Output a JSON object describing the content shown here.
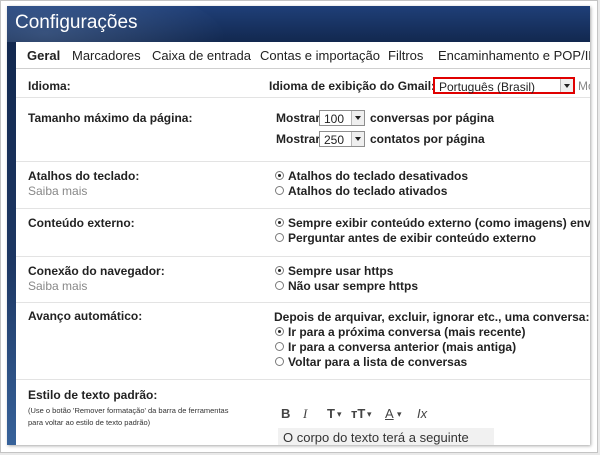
{
  "header": {
    "title": "Configurações"
  },
  "tabs": [
    {
      "label": "Geral"
    },
    {
      "label": "Marcadores"
    },
    {
      "label": "Caixa de entrada"
    },
    {
      "label": "Contas e importação"
    },
    {
      "label": "Filtros"
    },
    {
      "label": "Encaminhamento e POP/IMAP"
    }
  ],
  "idioma": {
    "label": "Idioma:",
    "display_label": "Idioma de exibição do Gmail:",
    "selected": "Português (Brasil)",
    "trailing": "Mo",
    "highlight_color": "#e00000"
  },
  "page_size": {
    "label": "Tamanho máximo da página:",
    "row1_prefix": "Mostrar",
    "row1_value": "100",
    "row1_suffix": "conversas por página",
    "row2_prefix": "Mostrar",
    "row2_value": "250",
    "row2_suffix": "contatos por página"
  },
  "shortcuts": {
    "label": "Atalhos do teclado:",
    "learn_more": "Saiba mais",
    "options": [
      "Atalhos do teclado desativados",
      "Atalhos do teclado ativados"
    ],
    "selected_index": 0
  },
  "external": {
    "label": "Conteúdo externo:",
    "options": [
      "Sempre exibir conteúdo externo (como imagens) enviad",
      "Perguntar antes de exibir conteúdo externo"
    ],
    "selected_index": 0
  },
  "browser": {
    "label": "Conexão do navegador:",
    "learn_more": "Saiba mais",
    "options": [
      "Sempre usar https",
      "Não usar sempre https"
    ],
    "selected_index": 0
  },
  "autoadvance": {
    "label": "Avanço automático:",
    "intro": "Depois de arquivar, excluir, ignorar etc., uma conversa:",
    "options": [
      "Ir para a próxima conversa (mais recente)",
      "Ir para a conversa anterior (mais antiga)",
      "Voltar para a lista de conversas"
    ],
    "selected_index": 0
  },
  "text_style": {
    "label": "Estilo de texto padrão:",
    "note_line1": "(Use o botão 'Remover formatação' da barra de ferramentas",
    "note_line2": "para voltar ao estilo de texto padrão)",
    "toolbar": {
      "bold": "B",
      "italic": "I",
      "font": "T",
      "size": "тT",
      "color": "A",
      "clear": "Ix",
      "caret": "▾"
    },
    "body_preview": "O corpo do texto terá a seguinte"
  }
}
